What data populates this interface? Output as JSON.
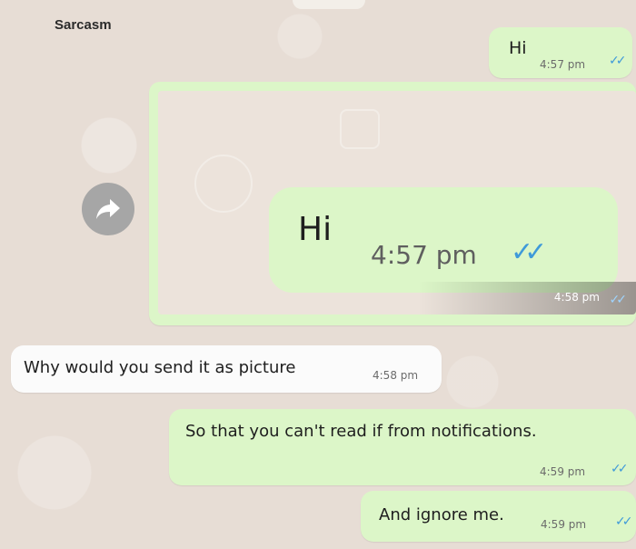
{
  "header": {
    "contact_name": "Sarcasm"
  },
  "messages": [
    {
      "text": "Hi",
      "time": "4:57 pm",
      "ticks": "✓✓"
    },
    {
      "image_text": "Hi",
      "image_time": "4:57 pm",
      "image_ticks": "✓✓",
      "time": "4:58 pm",
      "ticks": "✓✓"
    },
    {
      "text": "Why would you send it as picture",
      "time": "4:58 pm"
    },
    {
      "text": "So that you can't read if from notifications.",
      "time": "4:59 pm",
      "ticks": "✓✓"
    },
    {
      "text": "And ignore me.",
      "time": "4:59 pm",
      "ticks": "✓✓"
    }
  ],
  "icons": {
    "forward": "forward-arrow-icon",
    "read_receipt": "double-check-icon"
  },
  "colors": {
    "outgoing": "#dcf6c8",
    "incoming": "#fbfbfb",
    "ticks": "#3f9ad9",
    "wallpaper": "#e7ddd5"
  }
}
